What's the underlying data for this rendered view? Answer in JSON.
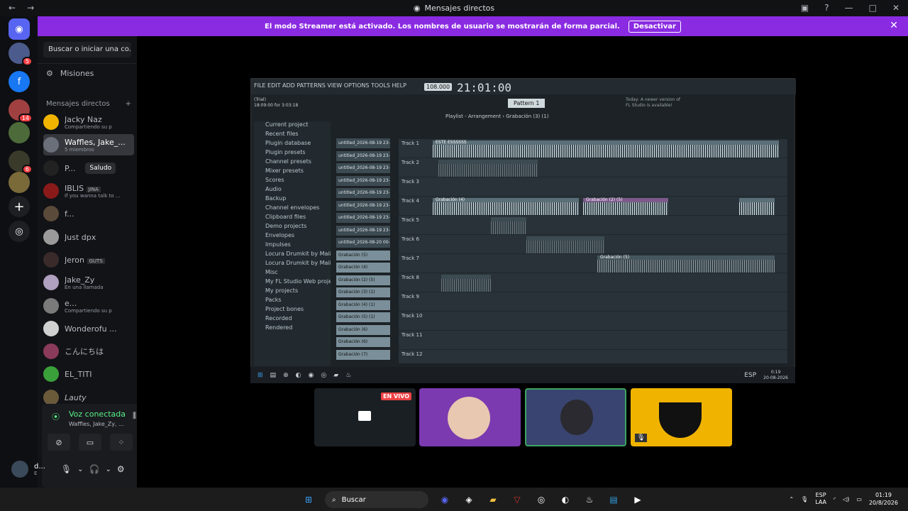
{
  "window": {
    "title": "Mensajes directos"
  },
  "banner": {
    "text": "El modo Streamer está activado. Los nombres de usuario se mostrarán de forma parcial.",
    "button": "Desactivar"
  },
  "rail": {
    "badges": [
      "5",
      "14",
      "6"
    ]
  },
  "sidebar": {
    "search_placeholder": "Buscar o iniciar una co...",
    "missions": "Misiones",
    "dm_header": "Mensajes directos",
    "dms": [
      {
        "name": "Jacky Naz",
        "sub": "Compartiendo su p"
      },
      {
        "name": "Waffles, Jake_...",
        "sub": "5 miembros"
      },
      {
        "name": "P...",
        "sub": ""
      },
      {
        "name": "IBLIS",
        "sub": "If you wanna talk to ..."
      },
      {
        "name": "f...",
        "sub": ""
      },
      {
        "name": "Just dpx",
        "sub": ""
      },
      {
        "name": "Jeron",
        "sub": ""
      },
      {
        "name": "Jake_Zy",
        "sub": "En una llamada"
      },
      {
        "name": "e...",
        "sub": "Compartiendo su p"
      },
      {
        "name": "Wonderofu ...",
        "sub": ""
      },
      {
        "name": "こんにちは",
        "sub": ""
      },
      {
        "name": "EL_TITI",
        "sub": ""
      },
      {
        "name": "Lauty",
        "sub": ""
      }
    ],
    "tags": [
      "Saludo",
      "JINA",
      "GUTS"
    ]
  },
  "voice": {
    "title": "Voz conectada",
    "subtitle": "Waffles, Jake_Zy, ..."
  },
  "user": {
    "name": "d...",
    "status": "E"
  },
  "fl": {
    "menu": "FILE  EDIT  ADD  PATTERNS  VIEW  OPTIONS  TOOLS  HELP",
    "time": "21:01:00",
    "tempo": "108.000",
    "pattern": "Pattern 1",
    "info": "(Trial)\n18:09:00 for 3:03:18",
    "notice": "Today: A newer version of FL Studio is available!",
    "playlist_title": "Playlist - Arrangement › Grabación (3) (1)",
    "browser": [
      "Current project",
      "Recent files",
      "Plugin database",
      "Plugin presets",
      "Channel presets",
      "Mixer presets",
      "Scores",
      "Audio",
      "Backup",
      "Channel envelopes",
      "Clipboard files",
      "Demo projects",
      "Envelopes",
      "Impulses",
      "Locura Drumkit by Maiizeno",
      "Locura Drumkit by Maiizeno",
      "Misc",
      "My FL Studio Web projects",
      "My projects",
      "Packs",
      "Project bones",
      "Recorded",
      "Rendered"
    ],
    "channels": [
      "untitled_2026-08-19 23-...",
      "untitled_2026-08-19 23-...",
      "untitled_2026-08-19 23-...",
      "untitled_2026-08-19 23-...",
      "untitled_2026-08-19 23-...",
      "untitled_2026-08-19 23-...",
      "untitled_2026-08-19 23-...",
      "untitled_2026-08-19 23-...",
      "untitled_2026-08-20 00-...",
      "Grabación (5)",
      "Grabación (4)",
      "Grabación (2) (5)",
      "Grabación (3) (1)",
      "Grabación (4) (1)",
      "Grabación (5) (1)",
      "Grabación (6)",
      "Grabación (6)",
      "Grabación (7)"
    ],
    "tracks": [
      "Track 1",
      "Track 2",
      "Track 3",
      "Track 4",
      "Track 5",
      "Track 6",
      "Track 7",
      "Track 8",
      "Track 9",
      "Track 10",
      "Track 11",
      "Track 12"
    ],
    "clip_labels": [
      "ESTE ESSSSSS",
      "Grabación (4)",
      "Grabación (2) (5)",
      "Grabación (5)"
    ],
    "taskbar": {
      "lang": "ESP",
      "time": "0:19",
      "date": "20-08-2026"
    }
  },
  "stream": {
    "live": "EN VIVO"
  },
  "taskbar": {
    "search": "Buscar",
    "lang": "ESP",
    "lang2": "LAA",
    "time": "01:19",
    "date": "20/8/2026"
  }
}
